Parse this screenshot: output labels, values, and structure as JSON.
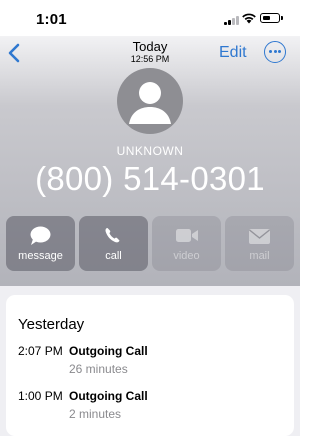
{
  "status_bar": {
    "time": "1:01"
  },
  "nav": {
    "title": "Today",
    "subtitle": "12:56 PM",
    "edit_label": "Edit"
  },
  "contact": {
    "name": "UNKNOWN",
    "phone": "(800) 514-0301"
  },
  "actions": [
    {
      "label": "message",
      "icon": "message-icon",
      "enabled": true
    },
    {
      "label": "call",
      "icon": "phone-icon",
      "enabled": true
    },
    {
      "label": "video",
      "icon": "video-icon",
      "enabled": false
    },
    {
      "label": "mail",
      "icon": "mail-icon",
      "enabled": false
    }
  ],
  "recents": {
    "header": "Yesterday",
    "calls": [
      {
        "time": "2:07 PM",
        "type": "Outgoing Call",
        "duration": "26 minutes"
      },
      {
        "time": "1:00 PM",
        "type": "Outgoing Call",
        "duration": "2 minutes"
      }
    ]
  },
  "colors": {
    "accent": "#2f78d0",
    "header_gradient_top": "#c9c9ce",
    "header_gradient_bottom": "#b2b3ba"
  }
}
